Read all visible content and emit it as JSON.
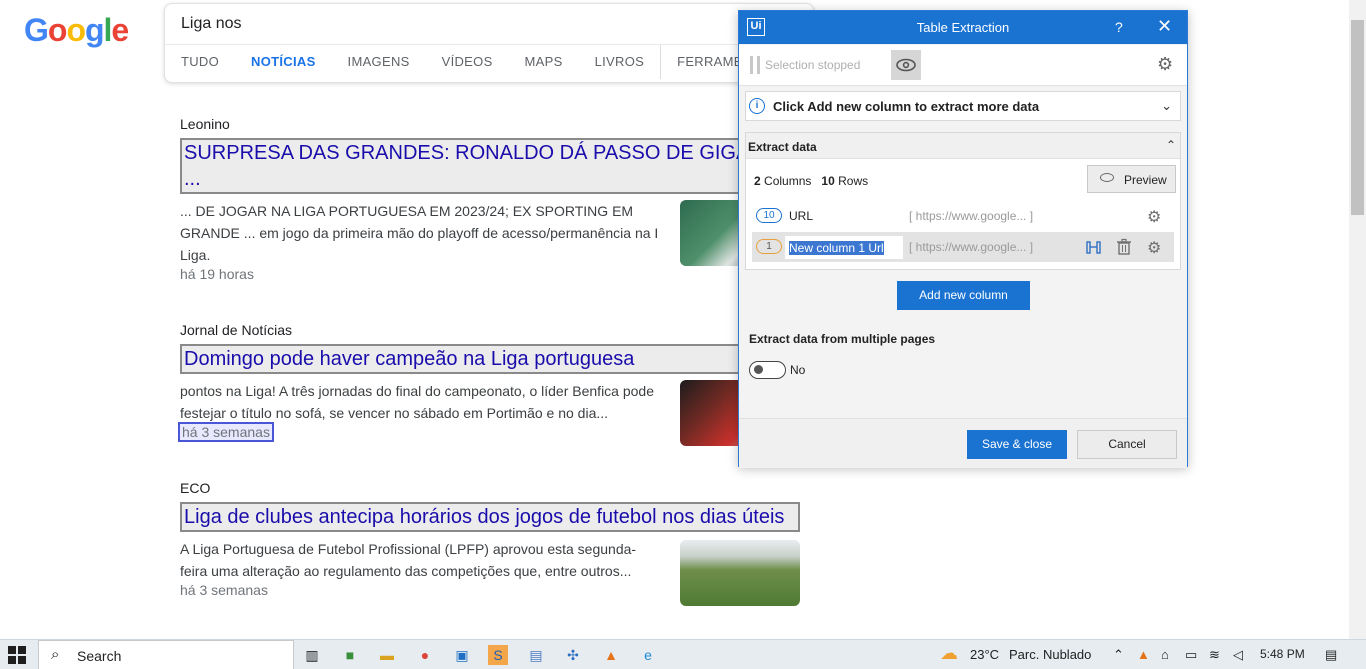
{
  "google": {
    "logo_letters": [
      "G",
      "o",
      "o",
      "g",
      "l",
      "e"
    ],
    "query": "Liga nos",
    "tabs": [
      "TUDO",
      "NOTÍCIAS",
      "IMAGENS",
      "VÍDEOS",
      "MAPS",
      "LIVROS",
      "FERRAMENTAS"
    ],
    "active_tab": "NOTÍCIAS"
  },
  "results": [
    {
      "source": "Leonino",
      "headline": "SURPRESA DAS GRANDES: RONALDO DÁ PASSO DE GIGANTE ...",
      "snippet": "... DE JOGAR NA LIGA PORTUGUESA EM 2023/24; EX SPORTING EM GRANDE ... em jogo da primeira mão do playoff de acesso/permanência na I Liga.",
      "time": "há 19 horas"
    },
    {
      "source": "Jornal de Notícias",
      "headline": "Domingo pode haver campeão na Liga portuguesa",
      "snippet": "pontos na Liga! A três jornadas do final do campeonato, o líder Benfica pode festejar o título no sofá, se vencer no sábado em Portimão e no dia...",
      "time": "há 3 semanas"
    },
    {
      "source": "ECO",
      "headline": "Liga de clubes antecipa horários dos jogos de futebol nos dias úteis",
      "snippet": "A Liga Portuguesa de Futebol Profissional (LPFP) aprovou esta segunda-feira uma alteração ao regulamento das competições que, entre outros...",
      "time": "há 3 semanas"
    }
  ],
  "dialog": {
    "logo": "Ui",
    "title": "Table Extraction",
    "help": "?",
    "close": "✕",
    "selection_status": "Selection stopped",
    "info_text": "Click Add new column to extract more data",
    "extract_section": "Extract data",
    "columns_count": "2",
    "columns_label": "Columns",
    "rows_count": "10",
    "rows_label": "Rows",
    "preview_label": "Preview",
    "columns": [
      {
        "badge": "10",
        "name": "URL",
        "value": "[ https://www.google... ]"
      },
      {
        "badge": "1",
        "name": "New column 1 Url",
        "value": "[ https://www.google... ]"
      }
    ],
    "add_column_label": "Add new column",
    "multi_pages_label": "Extract data from multiple pages",
    "multi_pages_value": "No",
    "save_label": "Save & close",
    "cancel_label": "Cancel"
  },
  "taskbar": {
    "search_label": "Search",
    "weather_temp": "23°C",
    "weather_desc": "Parc. Nublado",
    "time": "5:48 PM"
  },
  "colors": {
    "link": "#1a0dab",
    "uipath_blue": "#1a72d1",
    "active_tab": "#1a73e8"
  }
}
